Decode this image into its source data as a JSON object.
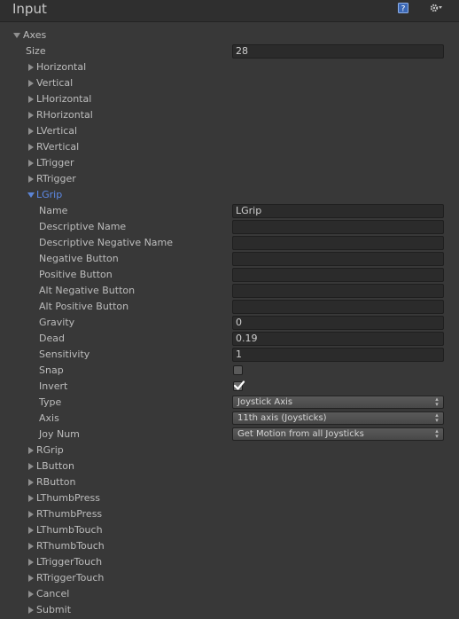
{
  "window": {
    "title": "Input",
    "icons": [
      "help-icon",
      "settings-gear-icon"
    ]
  },
  "axes": {
    "label": "Axes",
    "size_label": "Size",
    "size_value": "28",
    "before_items": [
      "Horizontal",
      "Vertical",
      "LHorizontal",
      "RHorizontal",
      "LVertical",
      "RVertical",
      "LTrigger",
      "RTrigger"
    ],
    "expanded_item": {
      "name": "LGrip",
      "properties": {
        "name_label": "Name",
        "name_value": "LGrip",
        "descriptive_name_label": "Descriptive Name",
        "descriptive_name_value": "",
        "descriptive_negative_name_label": "Descriptive Negative Name",
        "descriptive_negative_name_value": "",
        "negative_button_label": "Negative Button",
        "negative_button_value": "",
        "positive_button_label": "Positive Button",
        "positive_button_value": "",
        "alt_negative_button_label": "Alt Negative Button",
        "alt_negative_button_value": "",
        "alt_positive_button_label": "Alt Positive Button",
        "alt_positive_button_value": "",
        "gravity_label": "Gravity",
        "gravity_value": "0",
        "dead_label": "Dead",
        "dead_value": "0.19",
        "sensitivity_label": "Sensitivity",
        "sensitivity_value": "1",
        "snap_label": "Snap",
        "snap_checked": false,
        "invert_label": "Invert",
        "invert_checked": true,
        "type_label": "Type",
        "type_value": "Joystick Axis",
        "axis_label": "Axis",
        "axis_value": "11th axis (Joysticks)",
        "joy_num_label": "Joy Num",
        "joy_num_value": "Get Motion from all Joysticks"
      }
    },
    "after_items": [
      "RGrip",
      "LButton",
      "RButton",
      "LThumbPress",
      "RThumbPress",
      "LThumbTouch",
      "RThumbTouch",
      "LTriggerTouch",
      "RTriggerTouch",
      "Cancel",
      "Submit"
    ]
  }
}
